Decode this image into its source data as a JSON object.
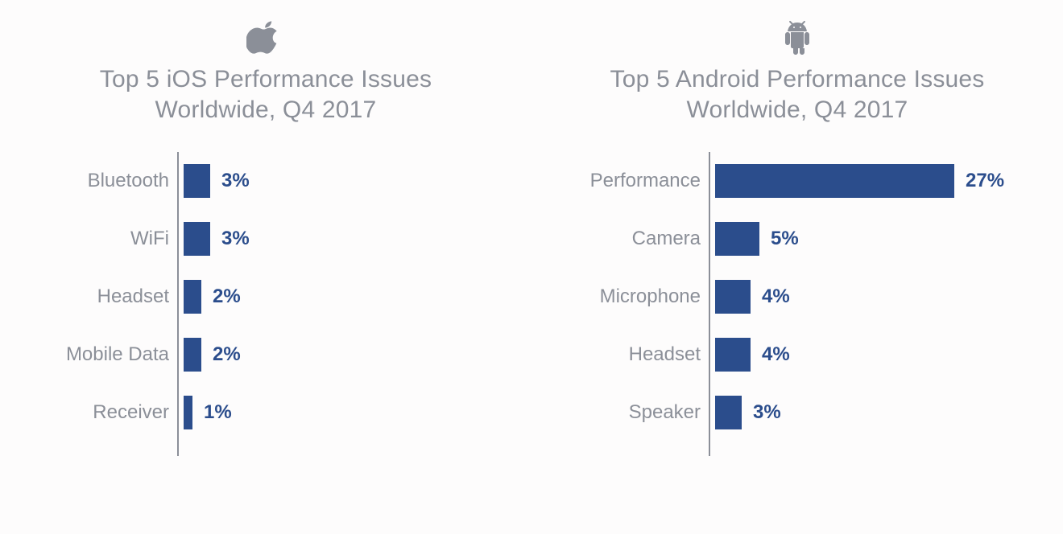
{
  "chart_data": [
    {
      "type": "bar",
      "orientation": "horizontal",
      "platform": "iOS",
      "icon": "apple",
      "title_line1": "Top 5 iOS Performance Issues",
      "title_line2": "Worldwide, Q4 2017",
      "categories": [
        "Bluetooth",
        "WiFi",
        "Headset",
        "Mobile Data",
        "Receiver"
      ],
      "values": [
        3,
        3,
        2,
        2,
        1
      ],
      "value_labels": [
        "3%",
        "3%",
        "2%",
        "2%",
        "1%"
      ],
      "x_max_percent": 30,
      "bar_color": "#2B4D8C",
      "text_color": "#8B8F98"
    },
    {
      "type": "bar",
      "orientation": "horizontal",
      "platform": "Android",
      "icon": "android",
      "title_line1": "Top 5 Android Performance Issues",
      "title_line2": "Worldwide, Q4 2017",
      "categories": [
        "Performance",
        "Camera",
        "Microphone",
        "Headset",
        "Speaker"
      ],
      "values": [
        27,
        5,
        4,
        4,
        3
      ],
      "value_labels": [
        "27%",
        "5%",
        "4%",
        "4%",
        "3%"
      ],
      "x_max_percent": 30,
      "bar_color": "#2B4D8C",
      "text_color": "#8B8F98"
    }
  ]
}
